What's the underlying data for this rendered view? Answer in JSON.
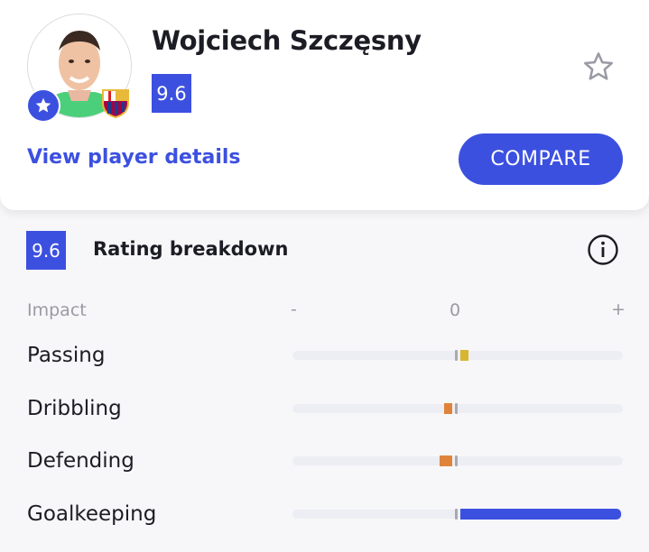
{
  "player": {
    "name": "Wojciech Szczęsny",
    "rating": "9.6",
    "details_link": "View player details",
    "compare_label": "COMPARE"
  },
  "icons": {
    "favorite": "star-outline-icon",
    "badge": "star-icon",
    "club": "club-crest-icon",
    "info": "info-icon"
  },
  "breakdown": {
    "rating": "9.6",
    "title": "Rating breakdown",
    "impact_label": "Impact",
    "axis": {
      "minus": "-",
      "zero": "0",
      "plus": "+"
    },
    "stats": [
      {
        "label": "Passing",
        "impact": 0.05,
        "color": "#d8b630"
      },
      {
        "label": "Dribbling",
        "impact": -0.05,
        "color": "#e0833a"
      },
      {
        "label": "Defending",
        "impact": -0.08,
        "color": "#e0833a"
      },
      {
        "label": "Goalkeeping",
        "impact": 1.0,
        "color": "#3c50e0"
      }
    ]
  },
  "colors": {
    "accent": "#3c50e0",
    "positive_small": "#d8b630",
    "negative": "#e0833a",
    "zero_tick": "#a9a9b0",
    "track": "#eceef3"
  }
}
